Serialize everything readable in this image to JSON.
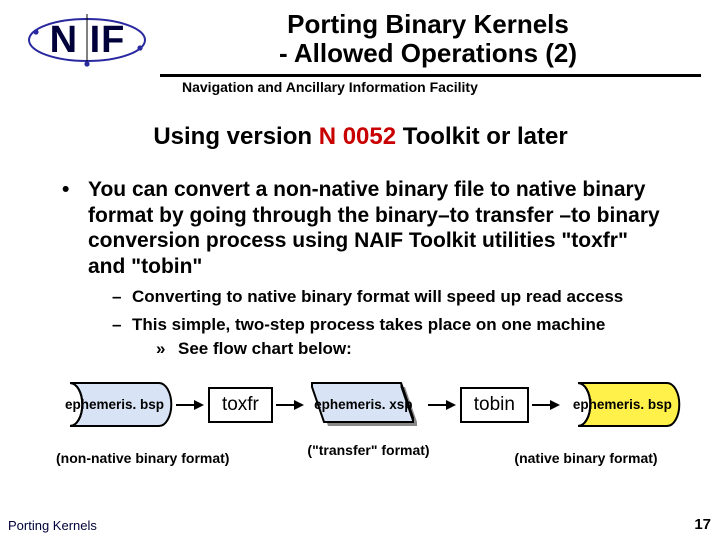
{
  "logo_text": "N IF",
  "title_line1": "Porting Binary Kernels",
  "title_line2": "- Allowed Operations (2)",
  "subtitle": "Navigation and Ancillary Information Facility",
  "headline_prefix": "Using version ",
  "headline_em": "N 0052",
  "headline_suffix": " Toolkit or later",
  "bullet1": "You can convert a non-native binary file to native binary format by going through the binary–to transfer –to binary conversion process using NAIF Toolkit utilities \"toxfr\" and \"tobin\"",
  "bullet2a": "Converting to native binary format will speed up read access",
  "bullet2b": "This simple, two-step process takes place on one machine",
  "bullet3": "See flow chart below:",
  "flow": {
    "file1": "ephemeris. bsp",
    "util1": "toxfr",
    "file2": "ephemeris. xsp",
    "util2": "tobin",
    "file3": "ephemeris. bsp",
    "caption_left": "(non-native binary format)",
    "caption_mid": "(\"transfer\" format)",
    "caption_right": "(native binary format)"
  },
  "footer_left": "Porting Kernels",
  "page_number": "17"
}
